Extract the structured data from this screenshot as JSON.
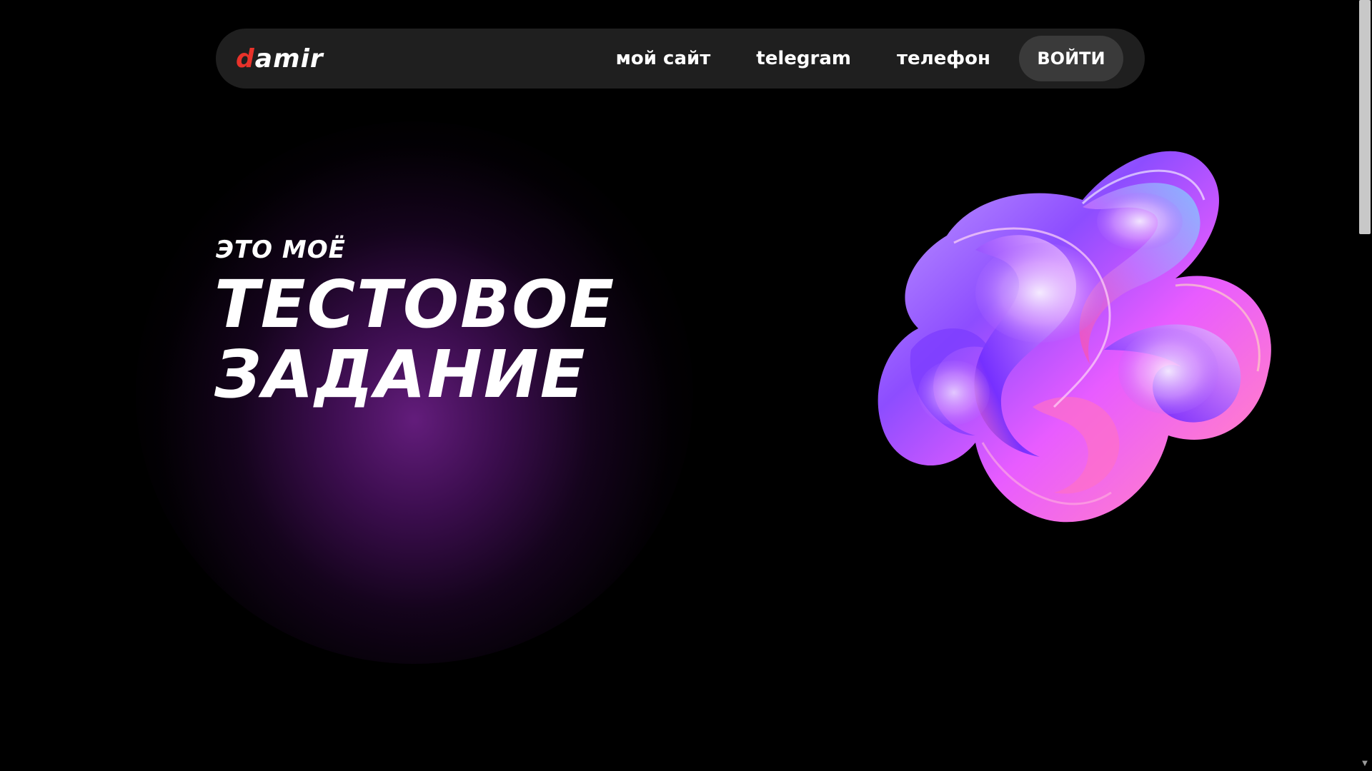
{
  "header": {
    "logo_prefix": "d",
    "logo_rest": "amir",
    "nav": [
      {
        "label": "мой сайт"
      },
      {
        "label": "telegram"
      },
      {
        "label": "телефон"
      }
    ],
    "login_label": "войти"
  },
  "hero": {
    "subtitle": "это моё",
    "title_line1": "тестовое",
    "title_line2": "задание"
  },
  "colors": {
    "background": "#000000",
    "header_bg": "#1f1f1f",
    "login_bg": "#3a3a3a",
    "logo_accent": "#e8322a",
    "glow": "#5a1275"
  },
  "icons": {
    "scroll_up": "chevron-up-icon",
    "scroll_down": "chevron-down-icon"
  }
}
